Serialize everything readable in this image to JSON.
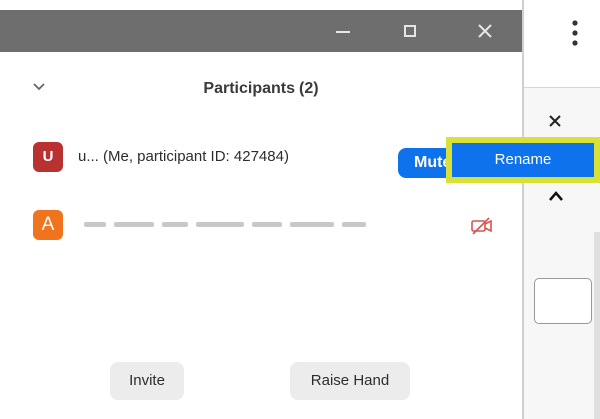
{
  "header": {
    "title": "Participants",
    "count": "(2)"
  },
  "participants": [
    {
      "avatar_letter": "U",
      "avatar_color": "#b83232",
      "name": "u... (Me, participant ID: 427484)",
      "action_label": "Mute"
    },
    {
      "avatar_letter": "A",
      "avatar_color": "#f0731e",
      "video_status": "video-off-icon"
    }
  ],
  "context_menu": {
    "item": "Rename"
  },
  "footer": {
    "invite_label": "Invite",
    "raise_hand_label": "Raise Hand"
  },
  "colors": {
    "titlebar": "#6e6e6e",
    "accent": "#0e72ed",
    "menu_highlight": "#d8e13a",
    "video_off": "#d9534f"
  }
}
